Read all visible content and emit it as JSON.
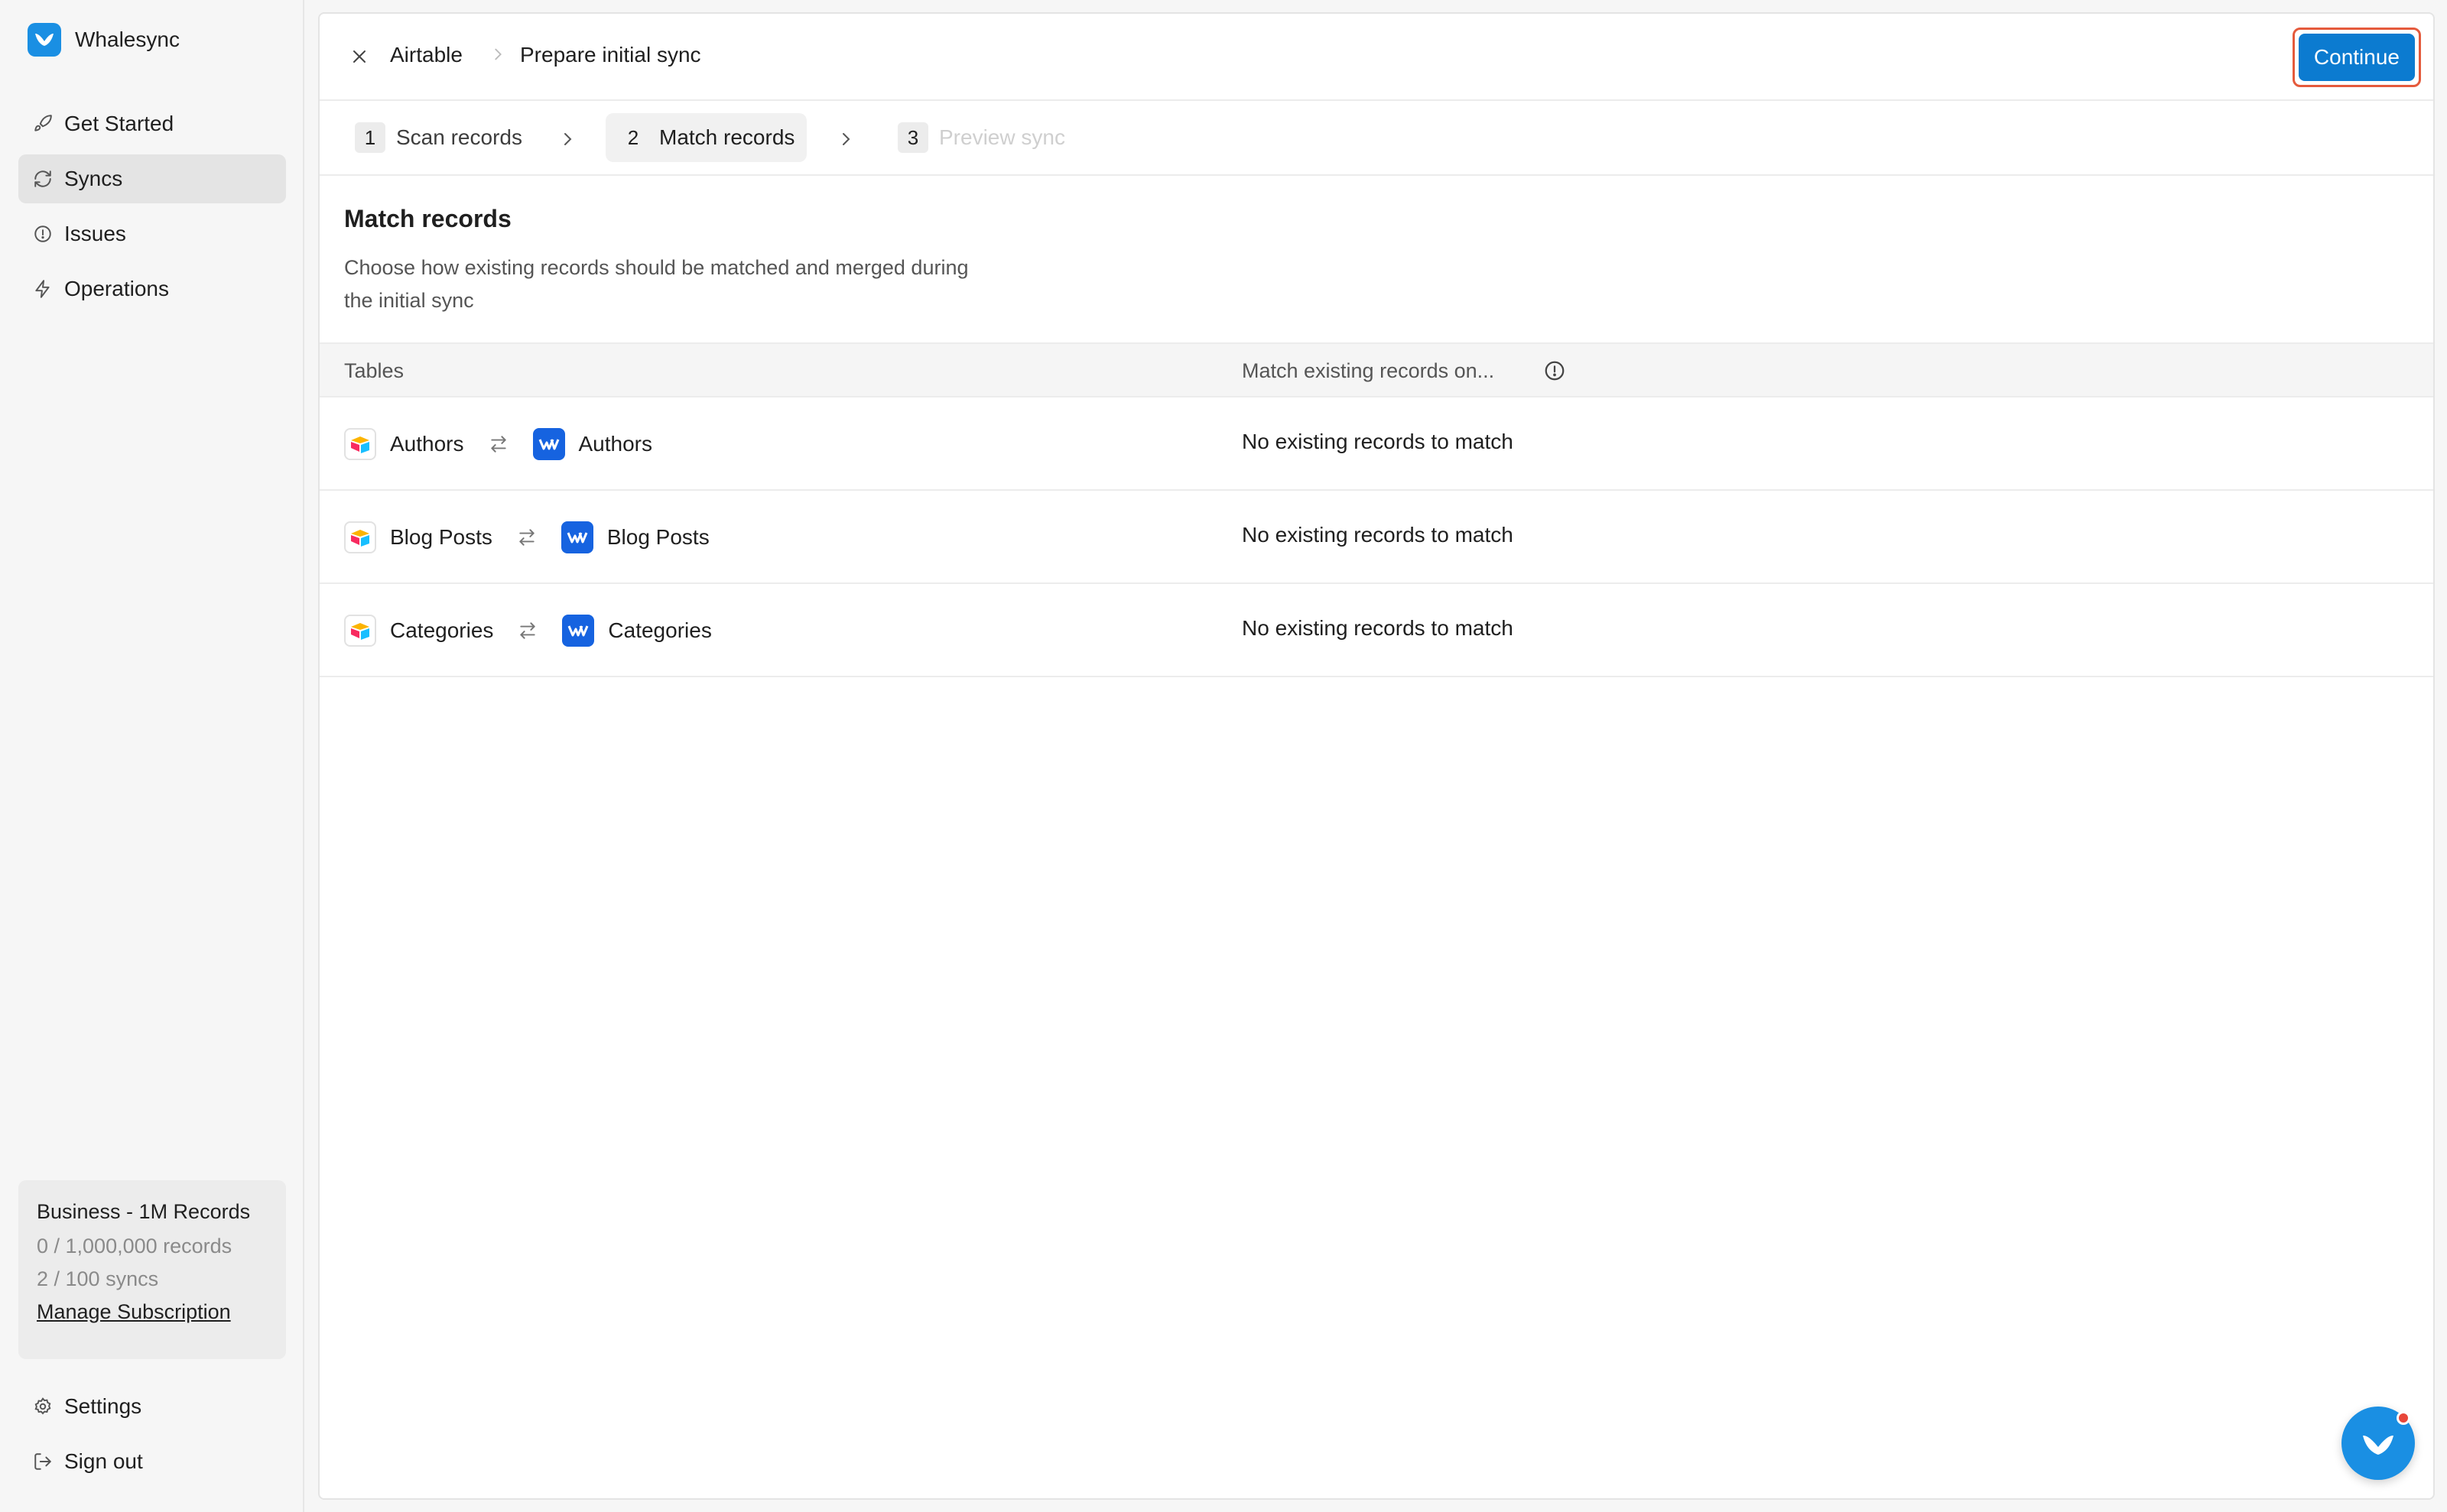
{
  "app": {
    "name": "Whalesync"
  },
  "sidebar": {
    "items": [
      {
        "label": "Get Started",
        "icon": "rocket-icon",
        "active": false
      },
      {
        "label": "Syncs",
        "icon": "sync-icon",
        "active": true
      },
      {
        "label": "Issues",
        "icon": "alert-circle-icon",
        "active": false
      },
      {
        "label": "Operations",
        "icon": "lightning-icon",
        "active": false
      }
    ],
    "plan": {
      "title": "Business - 1M Records",
      "records": "0 / 1,000,000 records",
      "syncs": "2 / 100 syncs",
      "manage_label": "Manage Subscription"
    },
    "bottom": [
      {
        "label": "Settings",
        "icon": "gear-icon"
      },
      {
        "label": "Sign out",
        "icon": "sign-out-icon"
      }
    ]
  },
  "header": {
    "breadcrumb": [
      "Airtable",
      "Prepare initial sync"
    ],
    "continue_label": "Continue"
  },
  "steps": [
    {
      "num": "1",
      "label": "Scan records",
      "state": "done"
    },
    {
      "num": "2",
      "label": "Match records",
      "state": "active"
    },
    {
      "num": "3",
      "label": "Preview sync",
      "state": "upcoming"
    }
  ],
  "section": {
    "title": "Match records",
    "description": "Choose how existing records should be matched and merged during the initial sync"
  },
  "table": {
    "headers": {
      "tables": "Tables",
      "match": "Match existing records on..."
    },
    "rows": [
      {
        "left": "Authors",
        "right": "Authors",
        "status": "No existing records to match"
      },
      {
        "left": "Blog Posts",
        "right": "Blog Posts",
        "status": "No existing records to match"
      },
      {
        "left": "Categories",
        "right": "Categories",
        "status": "No existing records to match"
      }
    ]
  },
  "colors": {
    "accent": "#0c7bd0",
    "brand": "#1a8fe3",
    "highlight_border": "#e55a3c",
    "webflow": "#1663e0"
  }
}
